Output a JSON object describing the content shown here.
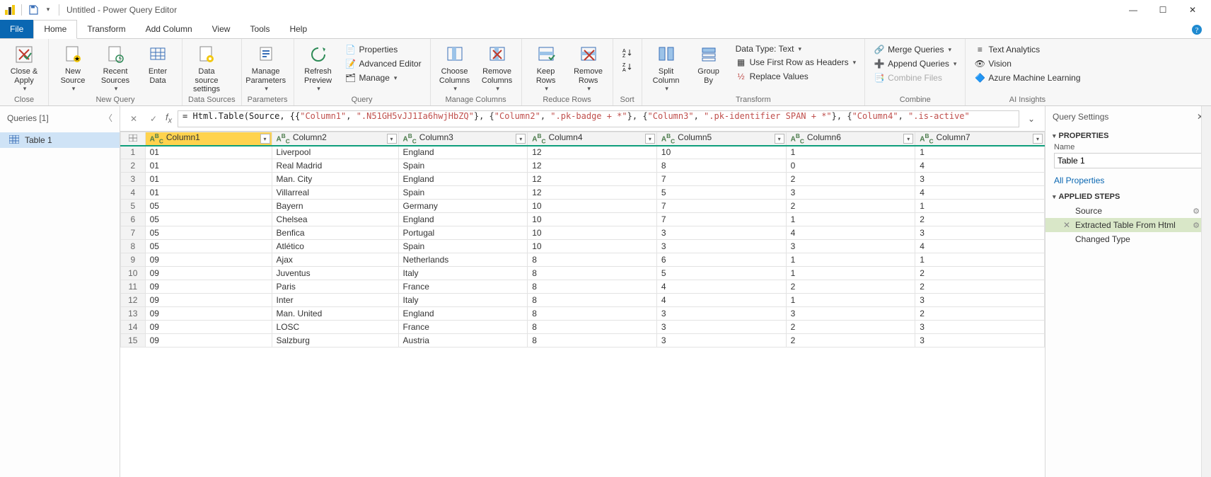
{
  "title": "Untitled - Power Query Editor",
  "tabs": {
    "file": "File",
    "home": "Home",
    "transform": "Transform",
    "addcolumn": "Add Column",
    "view": "View",
    "tools": "Tools",
    "help": "Help"
  },
  "ribbon": {
    "close_apply": "Close &\nApply",
    "close_group": "Close",
    "new_source": "New\nSource",
    "recent_sources": "Recent\nSources",
    "enter_data": "Enter\nData",
    "new_query_group": "New Query",
    "data_source_settings": "Data source\nsettings",
    "data_sources_group": "Data Sources",
    "manage_parameters": "Manage\nParameters",
    "parameters_group": "Parameters",
    "refresh_preview": "Refresh\nPreview",
    "properties": "Properties",
    "advanced_editor": "Advanced Editor",
    "manage": "Manage",
    "query_group": "Query",
    "choose_columns": "Choose\nColumns",
    "remove_columns": "Remove\nColumns",
    "manage_columns_group": "Manage Columns",
    "keep_rows": "Keep\nRows",
    "remove_rows": "Remove\nRows",
    "reduce_rows_group": "Reduce Rows",
    "sort_group": "Sort",
    "split_column": "Split\nColumn",
    "group_by": "Group\nBy",
    "data_type": "Data Type: Text",
    "first_row_headers": "Use First Row as Headers",
    "replace_values": "Replace Values",
    "transform_group": "Transform",
    "merge_queries": "Merge Queries",
    "append_queries": "Append Queries",
    "combine_files": "Combine Files",
    "combine_group": "Combine",
    "text_analytics": "Text Analytics",
    "vision": "Vision",
    "aml": "Azure Machine Learning",
    "ai_group": "AI Insights"
  },
  "queries_header": "Queries [1]",
  "query_name": "Table 1",
  "formula_prefix": "= Html.Table(Source, {{",
  "formula_parts": {
    "c1n": "\"Column1\"",
    "c1s": "\".N51GH5vJJ1Ia6hwjHbZQ\"",
    "c2n": "\"Column2\"",
    "c2s": "\".pk-badge + *\"",
    "c3n": "\"Column3\"",
    "c3s": "\".pk-identifier SPAN + *\"",
    "c4n": "\"Column4\"",
    "c4s": "\".is-active\""
  },
  "columns": [
    "Column1",
    "Column2",
    "Column3",
    "Column4",
    "Column5",
    "Column6",
    "Column7"
  ],
  "rows": [
    [
      "01",
      "Liverpool",
      "England",
      "12",
      "10",
      "1",
      "1"
    ],
    [
      "01",
      "Real Madrid",
      "Spain",
      "12",
      "8",
      "0",
      "4"
    ],
    [
      "01",
      "Man. City",
      "England",
      "12",
      "7",
      "2",
      "3"
    ],
    [
      "01",
      "Villarreal",
      "Spain",
      "12",
      "5",
      "3",
      "4"
    ],
    [
      "05",
      "Bayern",
      "Germany",
      "10",
      "7",
      "2",
      "1"
    ],
    [
      "05",
      "Chelsea",
      "England",
      "10",
      "7",
      "1",
      "2"
    ],
    [
      "05",
      "Benfica",
      "Portugal",
      "10",
      "3",
      "4",
      "3"
    ],
    [
      "05",
      "Atlético",
      "Spain",
      "10",
      "3",
      "3",
      "4"
    ],
    [
      "09",
      "Ajax",
      "Netherlands",
      "8",
      "6",
      "1",
      "1"
    ],
    [
      "09",
      "Juventus",
      "Italy",
      "8",
      "5",
      "1",
      "2"
    ],
    [
      "09",
      "Paris",
      "France",
      "8",
      "4",
      "2",
      "2"
    ],
    [
      "09",
      "Inter",
      "Italy",
      "8",
      "4",
      "1",
      "3"
    ],
    [
      "09",
      "Man. United",
      "England",
      "8",
      "3",
      "3",
      "2"
    ],
    [
      "09",
      "LOSC",
      "France",
      "8",
      "3",
      "2",
      "3"
    ],
    [
      "09",
      "Salzburg",
      "Austria",
      "8",
      "3",
      "2",
      "3"
    ]
  ],
  "settings": {
    "header": "Query Settings",
    "properties": "PROPERTIES",
    "name_label": "Name",
    "name_value": "Table 1",
    "all_props": "All Properties",
    "applied_steps": "APPLIED STEPS",
    "steps": [
      "Source",
      "Extracted Table From Html",
      "Changed Type"
    ]
  }
}
